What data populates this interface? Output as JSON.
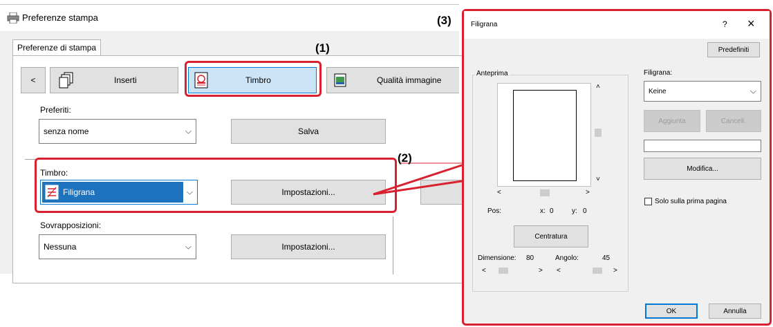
{
  "left_window": {
    "title": "Preferenze stampa",
    "tab": "Preferenze di stampa",
    "nav_prev": "<",
    "toolbar": {
      "inserti": "Inserti",
      "timbro": "Timbro",
      "qualita": "Qualità immagine"
    },
    "preferiti": {
      "label": "Preferiti:",
      "value": "senza nome",
      "save": "Salva"
    },
    "timbro": {
      "label": "Timbro:",
      "value": "Filigrana",
      "settings": "Impostazioni..."
    },
    "sovrapposizioni": {
      "label": "Sovrapposizioni:",
      "value": "Nessuna",
      "settings": "Impostazioni..."
    }
  },
  "callouts": {
    "c1": "(1)",
    "c2": "(2)",
    "c3": "(3)"
  },
  "dialog": {
    "title": "Filigrana",
    "help": "?",
    "close": "×",
    "predefiniti": "Predefiniti",
    "anteprima": "Anteprima",
    "pos_label": "Pos:",
    "x_label": "x:",
    "x_value": "0",
    "y_label": "y:",
    "y_value": "0",
    "centratura": "Centratura",
    "dimensione_label": "Dimensione:",
    "dimensione_value": "80",
    "angolo_label": "Angolo:",
    "angolo_value": "45",
    "filigrana_label": "Filigrana:",
    "filigrana_value": "Keine",
    "aggiunta": "Aggiunta",
    "cancell": "Cancell.",
    "text_value": "",
    "modifica": "Modifica...",
    "solo_prima": "Solo sulla prima pagina",
    "solo_prima_checked": false,
    "ok": "OK",
    "annulla": "Annulla"
  },
  "colors": {
    "accent": "#d8202f",
    "selected": "#1e73be",
    "tab_selected": "#cce4f7"
  }
}
